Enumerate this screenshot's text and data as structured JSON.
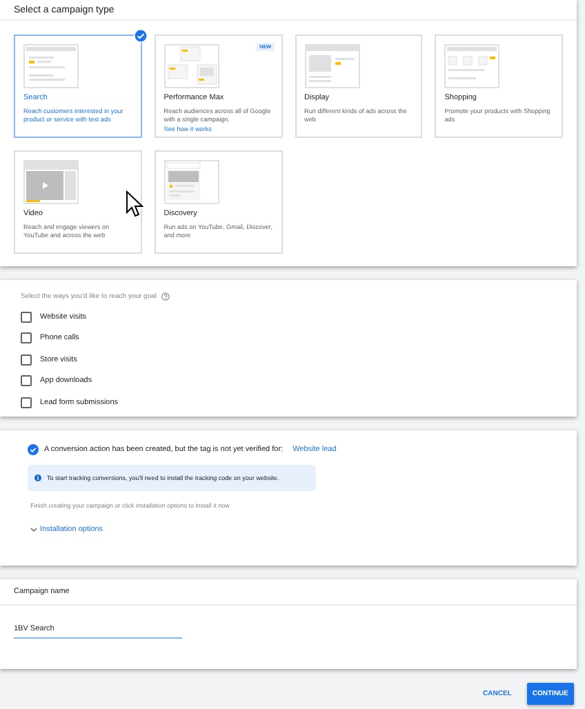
{
  "campaign_type": {
    "title": "Select a campaign type",
    "tiles": [
      {
        "kind": "search",
        "title": "Search",
        "description": "Reach customers interested in your product or service with test ads",
        "selected": true
      },
      {
        "kind": "pmax",
        "title": "Performance Max",
        "description": "Reach audiences across all of Google with a single campaign.",
        "link": "See how it works",
        "badge": "NEW",
        "selected": false
      },
      {
        "kind": "display",
        "title": "Display",
        "description": "Run different kinds of ads across the web",
        "selected": false
      },
      {
        "kind": "shopping",
        "title": "Shopping",
        "description": "Promote your products with Shopping ads",
        "selected": false
      },
      {
        "kind": "video",
        "title": "Video",
        "description": "Reach and engage viewers on YouTube and across the web",
        "selected": false
      },
      {
        "kind": "discovery",
        "title": "Discovery",
        "description": "Run ads on YouTube, Gmail, Discover, and more",
        "selected": false
      }
    ]
  },
  "goals": {
    "prompt": "Select the ways you'd like to reach your goal",
    "options": [
      {
        "label": "Website visits",
        "checked": false
      },
      {
        "label": "Phone calls",
        "checked": false
      },
      {
        "label": "Store visits",
        "checked": false
      },
      {
        "label": "App downloads",
        "checked": false
      },
      {
        "label": "Lead form submissions",
        "checked": false
      }
    ]
  },
  "conversion": {
    "message": "A conversion action has been created, but the tag is not yet verified for:",
    "link": "Website lead",
    "info": "To start tracking conversions, you'll need to install the tracking code on your website.",
    "note": "Finish creating your campaign or click installation options to install it now",
    "expander": "Installation options"
  },
  "campaign_name": {
    "title": "Campaign name",
    "value": "1BV Search"
  },
  "buttons": [
    {
      "label": "CANCEL",
      "kind": "text"
    },
    {
      "label": "CONTINUE",
      "kind": "primary"
    }
  ]
}
